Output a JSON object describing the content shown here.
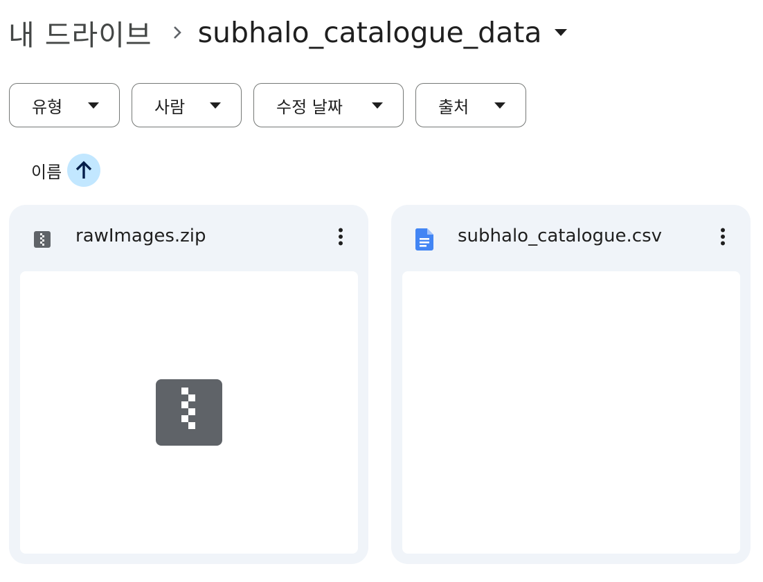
{
  "breadcrumb": {
    "root_label": "내 드라이브",
    "separator_icon": "chevron-right-icon",
    "current_folder": "subhalo_catalogue_data",
    "dropdown_icon": "arrow-drop-down-icon"
  },
  "filters": [
    {
      "label": "유형",
      "icon": "arrow-drop-down-icon"
    },
    {
      "label": "사람",
      "icon": "arrow-drop-down-icon"
    },
    {
      "label": "수정 날짜",
      "icon": "arrow-drop-down-icon"
    },
    {
      "label": "출처",
      "icon": "arrow-drop-down-icon"
    }
  ],
  "sort": {
    "label": "이름",
    "direction_icon": "arrow-upward-icon"
  },
  "files": [
    {
      "name": "rawImages.zip",
      "type_icon": "zip-file-icon",
      "menu_icon": "more-vert-icon",
      "thumbnail_icon": "zip-file-icon"
    },
    {
      "name": "subhalo_catalogue.csv",
      "type_icon": "google-docs-icon",
      "menu_icon": "more-vert-icon"
    }
  ],
  "colors": {
    "sort_button_bg": "#c2e7ff",
    "sort_arrow": "#041e49",
    "card_bg": "#f0f4f9",
    "zip_icon": "#5f6368",
    "docs_icon": "#4285f4"
  }
}
